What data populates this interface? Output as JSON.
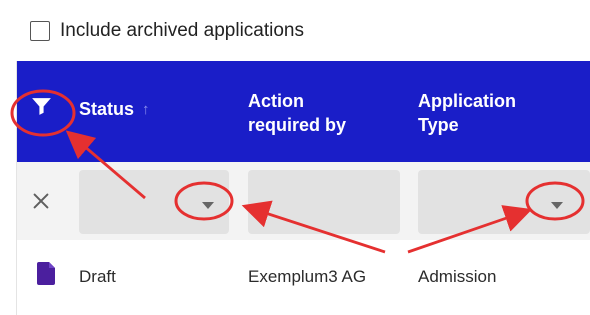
{
  "filters": {
    "include_archived_label": "Include archived applications",
    "include_archived_checked": false
  },
  "table": {
    "columns": [
      {
        "label": "Status",
        "sort_indicator": "↑"
      },
      {
        "label": "Action required by"
      },
      {
        "label": "Application Type"
      }
    ],
    "filter_row": {
      "clear_icon": "close-icon",
      "status_dropdown_icon": "chevron-down-icon",
      "action_dropdown_icon": "none",
      "type_dropdown_icon": "chevron-down-icon"
    },
    "rows": [
      {
        "icon": "document-icon",
        "status": "Draft",
        "action_required_by": "Exemplum3 AG",
        "application_type": "Admission"
      }
    ]
  },
  "icons": {
    "filter": "filter-icon",
    "clear": "close-icon",
    "document": "document-icon",
    "dropdown": "chevron-down-icon"
  },
  "colors": {
    "header_background": "#1a1ec8",
    "header_text": "#ffffff",
    "filter_row_background": "#f3f3f3",
    "filter_input_background": "#e2e2e2",
    "sort_arrow": "#8d90ef",
    "document_icon": "#4b1f9e",
    "annotation": "#e53030"
  }
}
